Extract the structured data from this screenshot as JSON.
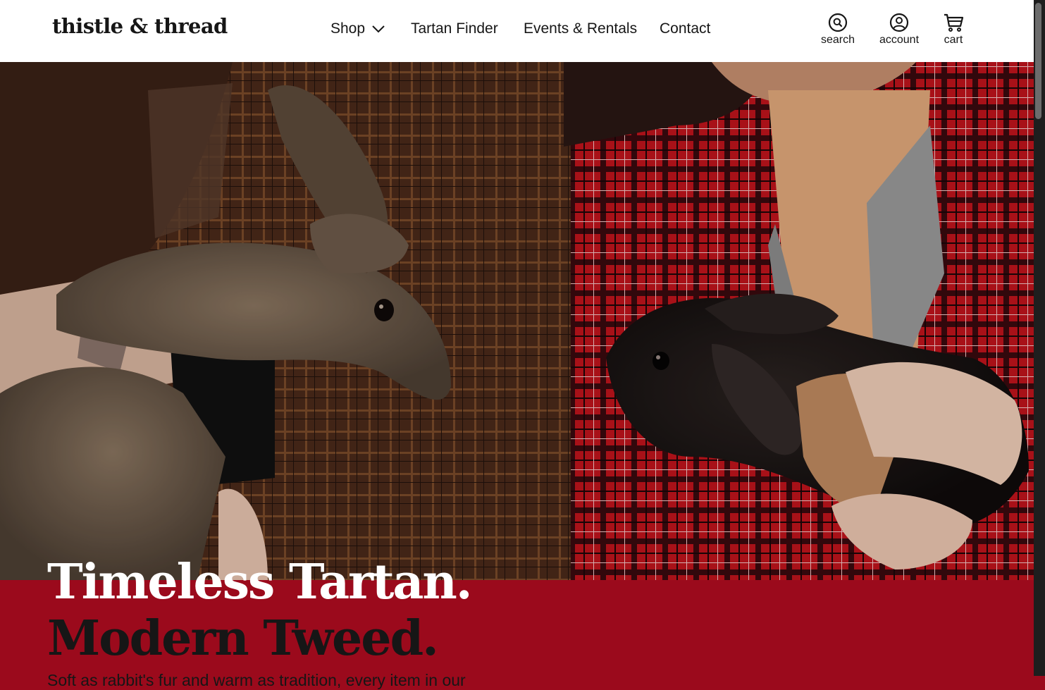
{
  "brand": {
    "logo_text": "thistle & thread"
  },
  "nav": {
    "items": [
      {
        "label": "Shop",
        "icon": "chevron-down-icon"
      },
      {
        "label": "Tartan Finder"
      },
      {
        "label": "Events & Rentals"
      },
      {
        "label": "Contact"
      }
    ]
  },
  "utility": {
    "search_label": "search",
    "account_label": "account",
    "cart_label": "cart"
  },
  "hero": {
    "image_subject": "Two people wearing tartan and plaid coats holding a brown rabbit and a black rabbit",
    "headline_line1": "Timeless Tartan.",
    "headline_line2": "Modern Tweed.",
    "subcopy": "Soft as rabbit's fur and warm as tradition, every item in our"
  },
  "colors": {
    "header_bg": "#ffffff",
    "text_dark": "#161616",
    "accent_red": "#9b0a1c",
    "headline_light": "#ffffff",
    "scrollbar_track": "#1e1e1e",
    "scrollbar_thumb": "#6c6c6c"
  }
}
